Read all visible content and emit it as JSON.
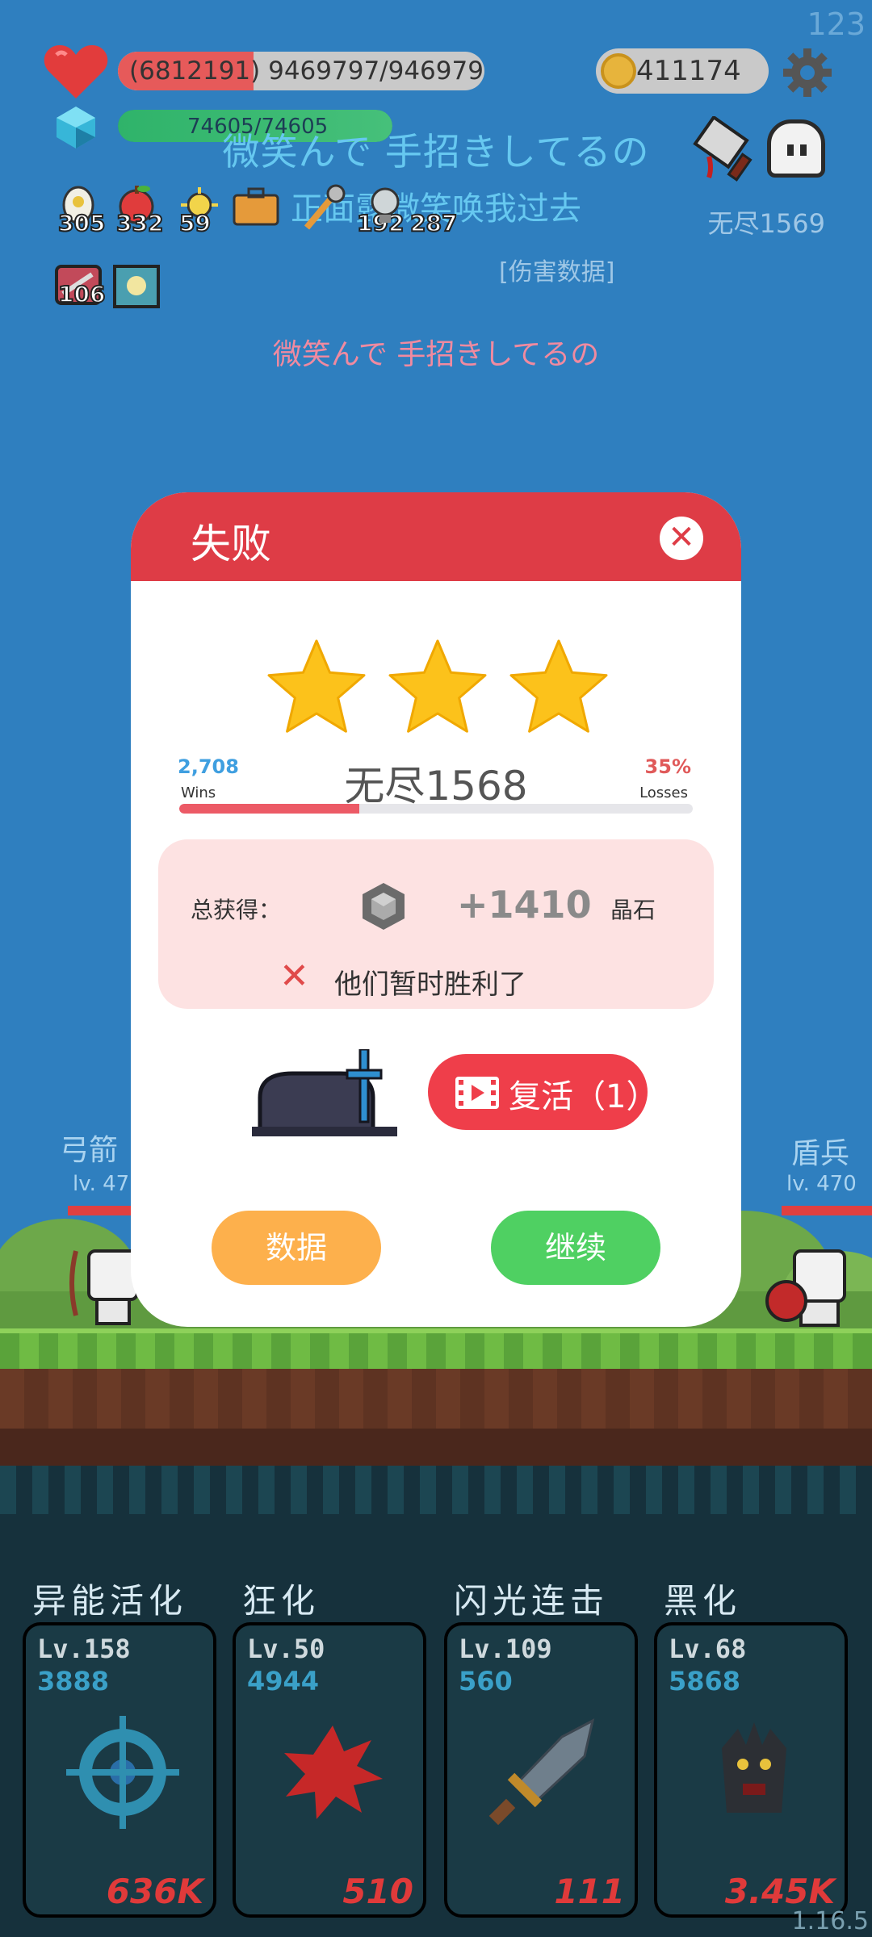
{
  "hud": {
    "fps": "123",
    "hp_text": "(6812191) 9469797/9469797",
    "hp_fraction": 0.37,
    "mp_text": "74605/74605",
    "mp_fraction": 1.0,
    "gold": "411174",
    "endless_label": "无尽1569",
    "damage_data_link": "[伤害数据]",
    "items": [
      {
        "icon": "egg-icon",
        "count": "305"
      },
      {
        "icon": "apple-icon",
        "count": "332"
      },
      {
        "icon": "lamp-icon",
        "count": "59"
      },
      {
        "icon": "briefcase-icon",
        "count": ""
      },
      {
        "icon": "tool-icon",
        "count": "192"
      },
      {
        "icon": "bulb-icon",
        "count": "287"
      }
    ],
    "items_row2": [
      {
        "icon": "scroll-icon",
        "count": "106"
      },
      {
        "icon": "frame-icon",
        "count": ""
      }
    ]
  },
  "lyrics": {
    "line1": "微笑んで 手招きしてるの",
    "line2": "正面露微笑唤我过去",
    "line3": "微笑んで 手招きしてるの"
  },
  "units": {
    "left_name": "弓箭",
    "left_level": "lv. 47",
    "right_name": "盾兵",
    "right_level": "lv. 470"
  },
  "modal": {
    "title": "失败",
    "close_icon": "close-icon",
    "stars": 3,
    "wins_value": "2,708",
    "wins_label": "Wins",
    "losses_value": "35%",
    "losses_label": "Losses",
    "stage": "无尽1568",
    "progress_fraction": 0.35,
    "reward_label": "总获得：",
    "reward_amount": "+1410",
    "reward_unit": "晶石",
    "defeat_msg": "他们暂时胜利了",
    "revive_label": "复活（1）",
    "data_button": "数据",
    "continue_button": "继续"
  },
  "skills": [
    {
      "name": "异能活化",
      "level": "Lv.158",
      "power": "3888",
      "cost": "636K",
      "icon": "target-icon"
    },
    {
      "name": "狂化",
      "level": "Lv.50",
      "power": "4944",
      "cost": "510",
      "icon": "splash-icon"
    },
    {
      "name": "闪光连击",
      "level": "Lv.109",
      "power": "560",
      "cost": "111",
      "icon": "sword-icon"
    },
    {
      "name": "黑化",
      "level": "Lv.68",
      "power": "5868",
      "cost": "3.45K",
      "icon": "dark-tree-icon"
    }
  ],
  "version": "1.16.5",
  "colors": {
    "sky": "#2f7fbf",
    "modal_header": "#de3c46",
    "revive": "#ef3e4a",
    "data_button": "#fdb04c",
    "continue_button": "#4fd062",
    "wins": "#3f9fe0",
    "losses": "#e05a5a"
  }
}
